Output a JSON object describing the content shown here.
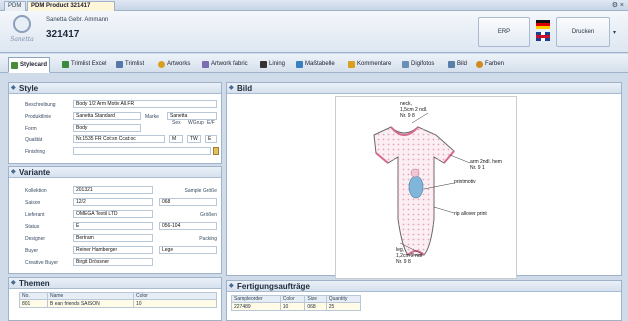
{
  "window": {
    "tab_inactive": "PDM",
    "tab_active": "PDM Product 321417",
    "controls": "⚙ ×"
  },
  "header": {
    "company": "Sanetta Gebr. Ammann",
    "product_id": "321417",
    "logo_script": "Sanetta",
    "erp_label": "ERP",
    "print_label": "Drucken",
    "more_label": "▾"
  },
  "tabs": [
    {
      "label": "Stylecard",
      "icon": "stylecard-icon",
      "color": "#4a8c3a"
    },
    {
      "label": "Trimlist Excel",
      "icon": "excel-icon",
      "color": "#3b8a3b"
    },
    {
      "label": "Trimlist",
      "icon": "list-icon",
      "color": "#5577aa"
    },
    {
      "label": "Artworks",
      "icon": "artwork-icon",
      "color": "#d9a020"
    },
    {
      "label": "Artwork fabric",
      "icon": "fabric-icon",
      "color": "#7a6db0"
    },
    {
      "label": "Lining",
      "icon": "lining-icon",
      "color": "#333333"
    },
    {
      "label": "Maßtabelle",
      "icon": "table-icon",
      "color": "#3a7fc0"
    },
    {
      "label": "Kommentare",
      "icon": "comment-icon",
      "color": "#d9a020"
    },
    {
      "label": "Digifotos",
      "icon": "photo-icon",
      "color": "#6a8fb5"
    },
    {
      "label": "Bild",
      "icon": "image-icon",
      "color": "#5a7fa8"
    },
    {
      "label": "Farben",
      "icon": "palette-icon",
      "color": "#d08a20"
    }
  ],
  "style_panel": {
    "title": "Style",
    "beschreibung_label": "Beschreibung",
    "beschreibung": "Body 1/2 Arm Motiv All.FR",
    "produktlinie_label": "Produktlinie",
    "produktlinie": "Sanetta Standard",
    "marke_label": "Marke",
    "marke": "Sanetta",
    "form_label": "Form",
    "form": "Body",
    "sex_label": "Sex",
    "wgrup_label": "WGrup",
    "ef_label": "E/F",
    "sex": "M",
    "wgrup": "TW",
    "ef": "E",
    "qualitaet_label": "Qualität",
    "qualitaet": "Nr.1535 FR Cot:sn Ccat:oc",
    "finishing_label": "Finishing",
    "finishing": ""
  },
  "variante_panel": {
    "title": "Variante",
    "kollektion_label": "Kollektion",
    "kollektion": "201321",
    "sample_groesse_label": "Sample Größe",
    "saison_label": "Saison",
    "saison": "12/2",
    "sample_groesse": "068",
    "lieferant_label": "Lieferant",
    "lieferant": "OMEGA Textil LTD",
    "groessen_label": "Größen",
    "status_label": "Status",
    "status": "E",
    "groessen": "056-104",
    "packing_label": "Packing",
    "designer_label": "Designer",
    "designer": "Bertram",
    "buyer_label": "Buyer",
    "buyer": "Reiner Hamberger",
    "packing": "Lege",
    "creative_buyer_label": "Creative Buyer",
    "creative_buyer": "Birgit Drössner"
  },
  "themen_panel": {
    "title": "Themen",
    "columns": [
      "No.",
      "Name",
      "Color"
    ],
    "rows": [
      [
        "801",
        "B ean friends SAISON",
        "10"
      ]
    ]
  },
  "bild_panel": {
    "title": "Bild",
    "annotations": {
      "neck": "neck,",
      "neck_detail": "1,5cm 2 ndl.",
      "neck_nr": "Nr. 9 8",
      "arm": "arm 2ndl. hem",
      "arm_nr": "Nr. 9 1",
      "printmotiv": "printmotiv",
      "allover": "rip allover print",
      "leg": "leg,",
      "leg_detail": "1,2cm 2 ndl",
      "leg_nr": "Nr. 9 8"
    }
  },
  "fertigung_panel": {
    "title": "Fertigungsaufträge",
    "columns": [
      "Sampleorder",
      "Color",
      "Size",
      "Quantity"
    ],
    "rows": [
      [
        "227489",
        "10",
        "068",
        "25"
      ]
    ]
  }
}
